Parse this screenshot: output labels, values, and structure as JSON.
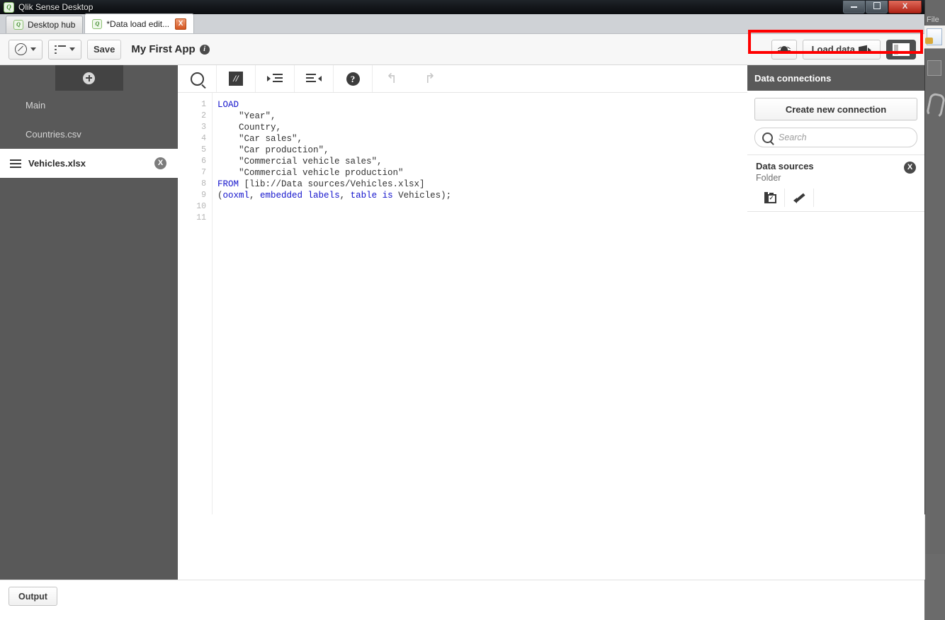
{
  "window": {
    "title": "Qlik Sense Desktop",
    "app_icon": "qlik-logo-icon",
    "minimize_label": "Minimize",
    "restore_label": "Restore",
    "close_label": "X"
  },
  "tabs": [
    {
      "label": "Desktop hub",
      "active": false,
      "closable": false
    },
    {
      "label": "*Data load edit...",
      "active": true,
      "closable": true,
      "close_label": "X"
    }
  ],
  "toolbar": {
    "navigation_label": "navigation-menu",
    "sheets_label": "sheets-menu",
    "save_label": "Save",
    "app_title": "My First App",
    "info_label": "i",
    "debug_label": "debug",
    "load_data_label": "Load data",
    "panel_toggle_label": "toggle-data-connections-panel"
  },
  "sections": {
    "add_label": "Add section",
    "items": [
      {
        "label": "Main",
        "active": false
      },
      {
        "label": "Countries.csv",
        "active": false
      },
      {
        "label": "Vehicles.xlsx",
        "active": true,
        "close_label": "X"
      }
    ]
  },
  "editor": {
    "toolbar": {
      "search_label": "search",
      "comment_label": "//",
      "indent_label": "indent",
      "outdent_label": "outdent",
      "help_label": "?",
      "undo_label": "↰",
      "redo_label": "↱"
    },
    "line_numbers": [
      "1",
      "2",
      "3",
      "4",
      "5",
      "6",
      "7",
      "8",
      "9",
      "10",
      "11"
    ],
    "code_lines": [
      [
        {
          "t": "LOAD",
          "c": "kw"
        }
      ],
      [
        {
          "t": "    \"Year\",",
          "c": ""
        }
      ],
      [
        {
          "t": "    Country,",
          "c": ""
        }
      ],
      [
        {
          "t": "    \"Car sales\",",
          "c": ""
        }
      ],
      [
        {
          "t": "    \"Car production\",",
          "c": ""
        }
      ],
      [
        {
          "t": "    \"Commercial vehicle sales\",",
          "c": ""
        }
      ],
      [
        {
          "t": "    \"Commercial vehicle production\"",
          "c": ""
        }
      ],
      [
        {
          "t": "FROM",
          "c": "kw"
        },
        {
          "t": " [lib://Data sources/Vehicles.xlsx]",
          "c": ""
        }
      ],
      [
        {
          "t": "(",
          "c": ""
        },
        {
          "t": "ooxml",
          "c": "fn"
        },
        {
          "t": ", ",
          "c": ""
        },
        {
          "t": "embedded labels",
          "c": "fn"
        },
        {
          "t": ", ",
          "c": ""
        },
        {
          "t": "table is",
          "c": "fn"
        },
        {
          "t": " Vehicles);",
          "c": ""
        }
      ],
      [
        {
          "t": "",
          "c": ""
        }
      ],
      [
        {
          "t": "",
          "c": ""
        }
      ]
    ]
  },
  "data_connections": {
    "header": "Data connections",
    "create_button": "Create new connection",
    "search_placeholder": "Search",
    "highlight_color": "#ff0000",
    "items": [
      {
        "name": "Data sources",
        "type": "Folder",
        "delete_label": "X",
        "select_data_label": "Select data",
        "edit_label": "Edit connection"
      }
    ]
  },
  "bottom": {
    "output_label": "Output"
  },
  "background_window": {
    "file_menu": "File"
  }
}
